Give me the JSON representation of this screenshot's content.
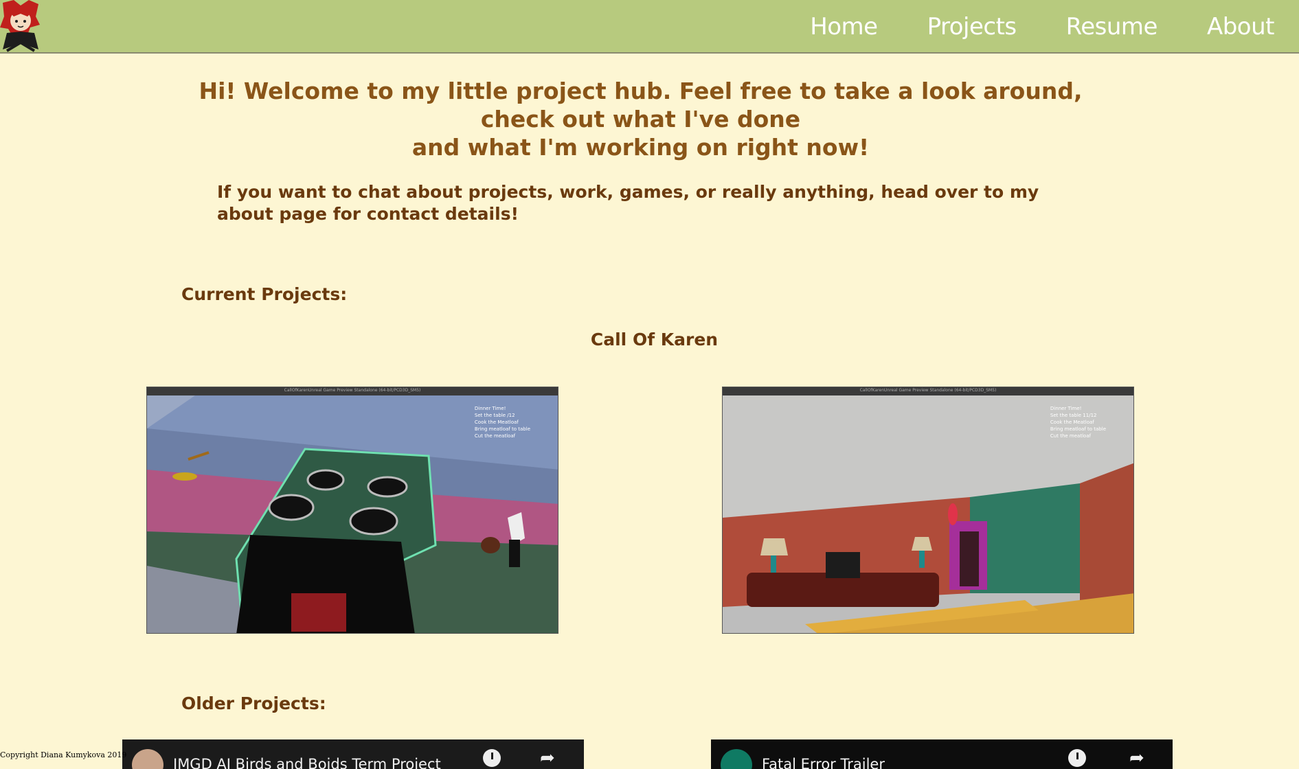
{
  "header": {
    "nav": [
      "Home",
      "Projects",
      "Resume",
      "About"
    ]
  },
  "intro": {
    "welcome_lines": [
      "Hi! Welcome to my little project hub. Feel free to take a look around,",
      "check out what I've done",
      "and what I'm working on right now!"
    ],
    "contact": "If you want to chat about projects, work, games, or really anything, head over to my about page for contact details!"
  },
  "current": {
    "heading": "Current Projects:",
    "project_title": "Call Of Karen",
    "screens": [
      {
        "window_title": "CallOfKarenUnreal Game Preview Standalone (64-bit/PCD3D_SM5)",
        "hud": [
          "Dinner Time!",
          "Set the table   /12",
          "Cook the Meatloaf",
          "Bring meatloaf to table",
          "Cut the meatloaf"
        ]
      },
      {
        "window_title": "CallOfKarenUnreal Game Preview Standalone (64-bit/PCD3D_SM5)",
        "hud": [
          "Dinner Time!",
          "Set the table  11/12",
          "Cook the Meatloaf",
          "Bring meatloaf to table",
          "Cut the meatloaf"
        ]
      }
    ]
  },
  "older": {
    "heading": "Older Projects:",
    "videos": [
      {
        "title": "IMGD AI Birds and Boids Term Project"
      },
      {
        "title": "Fatal Error Trailer"
      }
    ]
  },
  "footer": {
    "copyright": "Copyright Diana Kumykova 2019"
  },
  "colors": {
    "header_bg": "#b7ca7e",
    "page_bg": "#fdf6d3",
    "heading_text": "#8a5518",
    "body_text": "#6a3a0e"
  }
}
